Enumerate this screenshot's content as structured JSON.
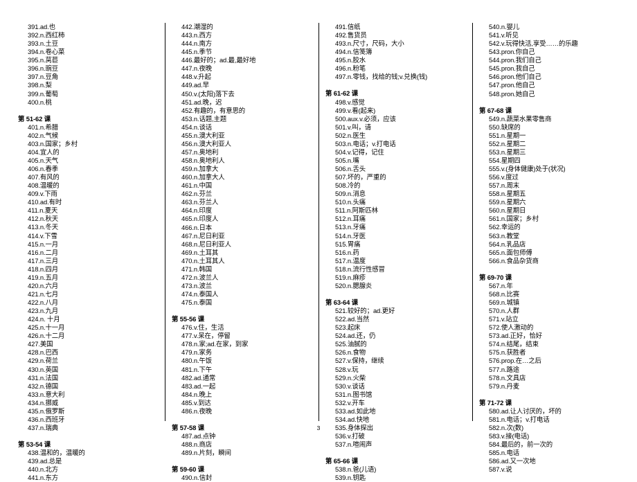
{
  "document": {
    "page_number": "3",
    "columns": [
      {
        "id": "column-1",
        "blocks": [
          {
            "type": "entries",
            "items": [
              "391.ad.也",
              "392.n.西红柿",
              "393.n.土豆",
              "394.n.卷心菜",
              "395.n.莴苣",
              "396.n.豌豆",
              "397.n.豆角",
              "398.n.梨",
              "399.n.葡萄",
              "400.n.桃"
            ]
          },
          {
            "type": "lesson",
            "label": "第 51-62 课"
          },
          {
            "type": "entries",
            "items": [
              "401.n.希腊",
              "402.n.气候",
              "403.n.国家；乡村",
              "404.宜人的",
              "405.n.天气",
              "406.n.春季",
              "407.有风的",
              "408.温暖的",
              "409.v.下雨",
              "410.ad.有时",
              "411.n.夏天",
              "412.n.秋天",
              "413.n.冬天",
              "414.v.下雪",
              "415.n.一月",
              "416.n.二月",
              "417.n.三月",
              "418.n.四月",
              "419.n.五月",
              "420.n.六月",
              "421.n.七月",
              "422.n.八月",
              "423.n.九月",
              "424.n. 十月",
              "425.n.十一月",
              "426.n.十二月",
              "427.美国",
              "428.n.巴西",
              "429.n.荷兰",
              "430.n.英国",
              "431.n.法国",
              "432.n.德国",
              "433.n.意大利",
              "434.n.挪威",
              "435.n.俄罗斯",
              "436.n.西班牙",
              "437.n.瑞典"
            ]
          },
          {
            "type": "lesson",
            "label": "第 53-54 课"
          },
          {
            "type": "entries",
            "items": [
              "438.温和的，温暖的",
              "439.ad.总是",
              "440.n.北方",
              "441.n.东方"
            ]
          }
        ]
      },
      {
        "id": "column-2",
        "blocks": [
          {
            "type": "entries",
            "items": [
              "442.潮湿的",
              "443.n.西方",
              "444.n.南方",
              "445.n.季节",
              "446.最好的；ad.最,最好地",
              "447.n.夜晚",
              "448.v.升起",
              "449.ad.早",
              "450.v.(太阳)落下去",
              "451.ad.晚，迟",
              "452.有趣的，有意思的",
              "453.n.话题,主题",
              "454.n.谈话",
              "455.n.澳大利亚",
              "456.n.澳大利亚人",
              "457.n.奥地利",
              "458.n.奥地利人",
              "459.n.加拿大",
              "460.n.加拿大人",
              "461.n.中国",
              "462.n.芬兰",
              "463.n.芬兰人",
              "464.n.印度",
              "465.n.印度人",
              "466.n.日本",
              "467.n.尼日利亚",
              "468.n.尼日利亚人",
              "469.n.土耳其",
              "470.n.土耳其人",
              "471.n.韩国",
              "472.n.波兰人",
              "473.n.波兰",
              "474.n.泰国人",
              "475.n.泰国"
            ]
          },
          {
            "type": "lesson",
            "label": "第 55-56 课"
          },
          {
            "type": "entries",
            "items": [
              "476.v.住，生活",
              "477.v.呆在，停留",
              "478.n.家;ad.在家，到家",
              "479.n.家务",
              "480.n.午饭",
              "481.n.下午",
              "482.ad.通常",
              "483.ad.一起",
              "484.n.晚上",
              "485.v.到达",
              "486.n.夜晚"
            ]
          },
          {
            "type": "lesson",
            "label": "第 57-58 课"
          },
          {
            "type": "entries",
            "items": [
              "487.ad.点钟",
              "488.n.商店",
              "489.n.片刻，瞬间"
            ]
          },
          {
            "type": "lesson",
            "label": "第 59-60 课"
          },
          {
            "type": "entries",
            "items": [
              "490.n.信封"
            ]
          }
        ]
      },
      {
        "id": "column-3",
        "blocks": [
          {
            "type": "entries",
            "items": [
              "491.信纸",
              "492.售货员",
              "493.n.尺寸，尺码，大小",
              "494.n.信笺簿",
              "495.n.胶水",
              "496.n.粉笔",
              "497.n.零钱，找给的钱;v.兑换(钱)"
            ]
          },
          {
            "type": "lesson",
            "label": "第 61-62 课"
          },
          {
            "type": "entries",
            "items": [
              "498.v.感觉",
              "499.v.看(起来)",
              "500.aux.v.必须，应该",
              "501.v.叫，请",
              "502.n.医生",
              "503.n.电话；v.打电话",
              "504.v.记得，记住",
              "505.n.嘴",
              "506.n.舌头",
              "507.坏的，严重的",
              "508.冷的",
              "509.n.消息",
              "510.n.头痛",
              "511.n.阿斯匹林",
              "512.n.耳痛",
              "513.n.牙痛",
              "514.n.牙医",
              "515.胃痛",
              "516.n.药",
              "517.n.温度",
              "518.n.流行性感冒",
              "519.n.麻疹",
              "520.n.腮腺炎"
            ]
          },
          {
            "type": "lesson",
            "label": "第 63-64 课"
          },
          {
            "type": "entries",
            "items": [
              "521.较好的；ad.更好",
              "522.ad.当然",
              "523.起床",
              "524.ad.还，仍",
              "525.油腻的",
              "526.n.食物",
              "527.v.保持，继续",
              "528.v.玩",
              "529.n.火柴",
              "530.v.谈话",
              "531.n.图书馆",
              "532.v.开车",
              "533.ad.如此地",
              "534.ad.快地",
              "535.身体探出",
              "536.v.打破",
              "537.n.喧闹声"
            ]
          },
          {
            "type": "lesson",
            "label": "第 65-66 课"
          },
          {
            "type": "entries",
            "items": [
              "538.n.爸(儿语)",
              "539.n.钥匙"
            ]
          }
        ]
      },
      {
        "id": "column-4",
        "blocks": [
          {
            "type": "entries",
            "items": [
              "540.n.婴儿",
              "541.v.听见",
              "542.v.玩得快活,享受……的乐趣",
              "543.pron.你自己",
              "544.pron.我们自己",
              "545.pron.我自己",
              "546.pron.他们自己",
              "547.pron.他自己",
              "548.pron.她自己"
            ]
          },
          {
            "type": "lesson",
            "label": "第 67-68 课"
          },
          {
            "type": "entries",
            "items": [
              "549.n.蔬菜水果零售商",
              "550.缺席的",
              "551.n.星期一",
              "552.n.星期二",
              "553.n.星期三",
              "554.星期四",
              "555.v.(身体健康)处于(状况)",
              "556.v.度过",
              "557.n.周末",
              "558.n.星期五",
              "559.n.星期六",
              "560.n.星期日",
              "561.n.国家；乡村",
              "562.幸运的",
              "563.n.教堂",
              "564.n.乳品店",
              "565.n.面包师傅",
              "566.n.食品杂货商"
            ]
          },
          {
            "type": "lesson",
            "label": "第 69-70 课"
          },
          {
            "type": "entries",
            "items": [
              "567.n.年",
              "568.n.比赛",
              "569.n.城镇",
              "570.n.人群",
              "571.v.站立",
              "572.使人激动的",
              "573.ad.正好，恰好",
              "574.n.结尾，结束",
              "575.n.获胜者",
              "576.prop.在…之后",
              "577.n.路途",
              "578.n.文具店",
              "579.n.丹麦"
            ]
          },
          {
            "type": "lesson",
            "label": "第 71-72 课"
          },
          {
            "type": "entries",
            "items": [
              "580.ad.让人讨厌的，坏的",
              "581.n.电话；v.打电话",
              "582.n.次(数)",
              "583.v.接(电话)",
              "584.最后的，前一次的",
              "585.n.电话",
              "586.ad.又一次地",
              "587.v.说"
            ]
          }
        ]
      }
    ]
  }
}
